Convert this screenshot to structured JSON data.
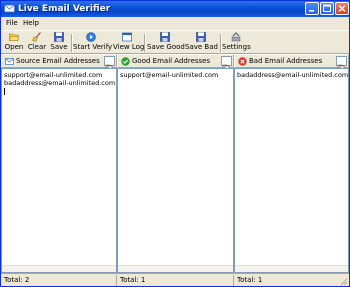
{
  "window": {
    "title": "Live Email Verifier"
  },
  "menu": {
    "items": [
      "File",
      "Help"
    ]
  },
  "toolbar": {
    "open": "Open",
    "clear": "Clear",
    "save": "Save",
    "start_verify": "Start Verify",
    "view_log": "View Log",
    "save_good": "Save Good",
    "save_bad": "Save Bad",
    "settings": "Settings"
  },
  "panels": {
    "source": {
      "title": "Source Email Addresses",
      "lines": [
        "support@email-unlimited.com",
        "badaddress@email-unlimited.com"
      ],
      "total": "Total: 2"
    },
    "good": {
      "title": "Good Email Addresses",
      "lines": [
        "support@email-unlimited.com"
      ],
      "total": "Total: 1"
    },
    "bad": {
      "title": "Bad Email Addresses",
      "lines": [
        "badaddress@email-unlimited.com"
      ],
      "total": "Total: 1"
    }
  },
  "icons": {
    "app": "envelope-icon",
    "open": "folder-open-icon",
    "clear": "broom-icon",
    "save": "floppy-disk-icon",
    "start_verify": "play-icon",
    "view_log": "log-window-icon",
    "save_good": "floppy-disk-icon",
    "save_bad": "floppy-disk-icon",
    "settings": "settings-tools-icon",
    "source_header": "mail-icon",
    "good_header": "green-check-icon",
    "bad_header": "red-x-icon"
  },
  "colors": {
    "titlebar": "#0a52d8",
    "good": "#2e9e2e",
    "bad": "#d83a2a"
  }
}
